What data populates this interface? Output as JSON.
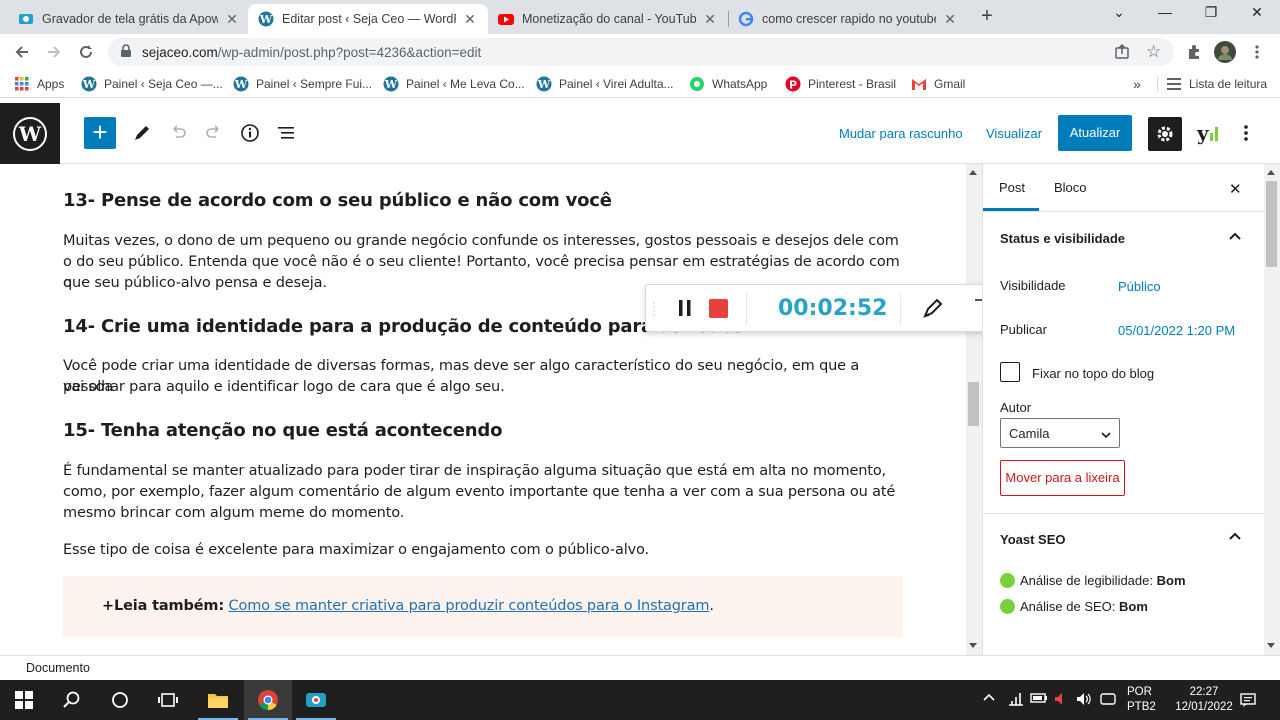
{
  "browser": {
    "tabs": [
      {
        "title": "Gravador de tela grátis da Apowe",
        "icon": "apowersoft-icon"
      },
      {
        "title": "Editar post ‹ Seja Ceo — WordPr",
        "icon": "wordpress-icon",
        "active": true
      },
      {
        "title": "Monetização do canal - YouTube",
        "icon": "youtube-icon"
      },
      {
        "title": "como crescer rapido no youtube",
        "icon": "google-icon"
      }
    ],
    "url_host": "sejaceo.com",
    "url_path": "/wp-admin/post.php?post=4236&action=edit",
    "bookmarks": [
      {
        "label": "Apps",
        "icon": "apps-grid-icon"
      },
      {
        "label": "Painel ‹ Seja Ceo —...",
        "icon": "wordpress-icon"
      },
      {
        "label": "Painel ‹ Sempre Fui...",
        "icon": "wordpress-icon"
      },
      {
        "label": "Painel ‹ Me Leva Co...",
        "icon": "wordpress-icon"
      },
      {
        "label": "Painel ‹ Virei Adulta...",
        "icon": "wordpress-icon"
      },
      {
        "label": "WhatsApp",
        "icon": "whatsapp-icon"
      },
      {
        "label": "Pinterest - Brasil",
        "icon": "pinterest-icon"
      },
      {
        "label": "Gmail",
        "icon": "gmail-icon"
      }
    ],
    "reading_list": "Lista de leitura"
  },
  "editor": {
    "switch_draft": "Mudar para rascunho",
    "preview": "Visualizar",
    "update": "Atualizar",
    "accent": "#007cba"
  },
  "content": {
    "h13": "13- Pense de acordo com o seu público e não com você",
    "p13_l1": "Muitas vezes, o dono de um pequeno ou grande negócio confunde os interesses, gostos pessoais e desejos dele com",
    "p13_l2": "o do seu público. Entenda que você não é o seu cliente! Portanto, você precisa pensar em estratégias de acordo com o",
    "p13_l3": "que  seu público-alvo pensa e deseja.",
    "h14": "14- Crie uma identidade para a produção de conteúdo para as redes",
    "p14_l1": "Você pode criar uma identidade de diversas formas, mas deve ser algo característico do seu negócio, em que a pessoa",
    "p14_l2": "vai olhar para aquilo e identificar logo de cara que é algo seu.",
    "h15": "15- Tenha atenção no que está acontecendo",
    "p15_l1": "É fundamental se manter atualizado para poder tirar de inspiração alguma situação que está em alta no momento,",
    "p15_l2": "como, por exemplo, fazer algum comentário de algum evento importante que tenha a ver com a sua persona ou até",
    "p15_l3": "mesmo brincar com algum meme do momento.",
    "p16": "Esse tipo de coisa é excelente para maximizar o engajamento com o público-alvo.",
    "readmore_label": "+Leia também:",
    "readmore_link": "Como se manter criativa para produzir conteúdos para o Instagram",
    "readmore_end": "."
  },
  "recorder": {
    "time": "00:02:52"
  },
  "sidebar": {
    "tab_post": "Post",
    "tab_block": "Bloco",
    "status_title": "Status e visibilidade",
    "visibility_label": "Visibilidade",
    "visibility_value": "Público",
    "publish_label": "Publicar",
    "publish_value": "05/01/2022 1:20 PM",
    "sticky_label": "Fixar no topo do blog",
    "author_label": "Autor",
    "author_value": "Camila",
    "trash": "Mover para a lixeira",
    "yoast_title": "Yoast SEO",
    "readability_label": "Análise de legibilidade:",
    "readability_value": "Bom",
    "seo_label": "Análise de SEO:",
    "seo_value": "Bom"
  },
  "footer": {
    "breadcrumb": "Documento"
  },
  "taskbar": {
    "lang1": "POR",
    "lang2": "PTB2",
    "time": "22:27",
    "date": "12/01/2022"
  }
}
